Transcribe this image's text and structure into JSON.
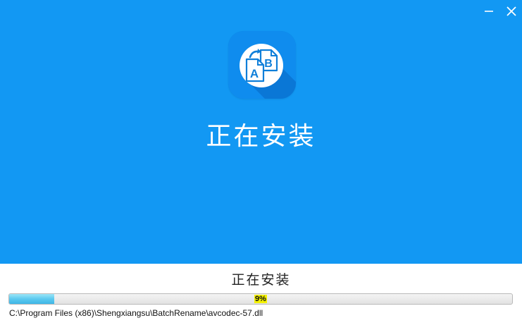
{
  "window": {
    "minimize_icon": "minimize-icon",
    "close_icon": "close-icon"
  },
  "app_icon": {
    "icon": "batch-rename-document-icon",
    "letter_a": "A",
    "letter_b": "B"
  },
  "hero": {
    "title": "正在安装"
  },
  "status": {
    "title": "正在安装",
    "progress_percent": 9,
    "progress_label": "9%",
    "current_file": "C:\\Program Files (x86)\\Shengxiangsu\\BatchRename\\avcodec-57.dll"
  },
  "colors": {
    "hero_background": "#1298f3",
    "icon_background": "#0a7fe0",
    "progress_fill": "#5cc9ef",
    "progress_label_highlight": "#f4f100"
  }
}
